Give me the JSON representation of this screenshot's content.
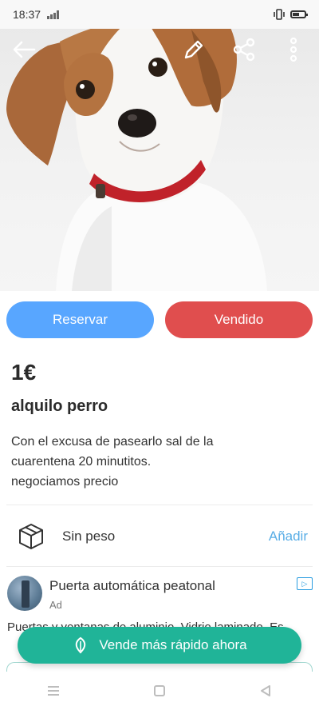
{
  "status_bar": {
    "time": "18:37"
  },
  "hero": {
    "description_icon": "dog-photo",
    "toolbar": {
      "back_icon": "arrow-left-icon",
      "edit_icon": "pencil-icon",
      "share_icon": "share-icon",
      "more_icon": "more-vertical-icon"
    }
  },
  "actions": {
    "reserve_label": "Reservar",
    "sold_label": "Vendido",
    "reserve_color": "#58a6ff",
    "sold_color": "#e04e4e"
  },
  "item": {
    "price": "1€",
    "title": "alquilo perro",
    "description": "Con el excusa de pasearlo sal de la\ncuarentena 20 minutitos.\nnegociamos precio"
  },
  "shipping": {
    "icon": "box-icon",
    "label": "Sin peso",
    "action": "Añadir"
  },
  "ad": {
    "title": "Puerta automática peatonal",
    "label": "Ad",
    "body": "Puertas y ventanas de aluminio. Vidrio laminado. Es..."
  },
  "sell_button": {
    "label": "Vende más rápido ahora",
    "color": "#20b498"
  }
}
